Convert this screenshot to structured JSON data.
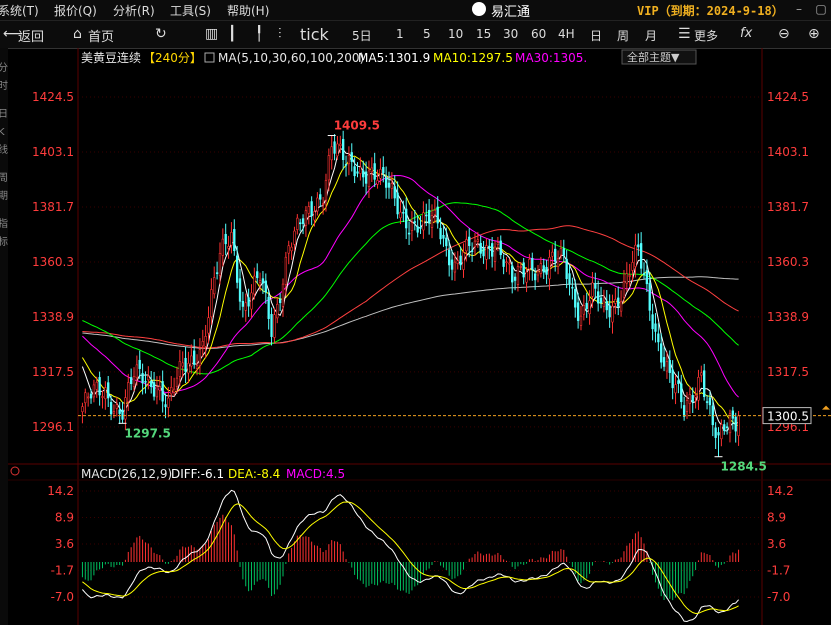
{
  "menu": {
    "items": [
      "系统(T)",
      "报价(Q)",
      "分析(R)",
      "工具(S)",
      "帮助(H)"
    ],
    "brand": "易汇通",
    "vip": "VIP（到期：2024-9-18）"
  },
  "toolbar": {
    "back": "返回",
    "home": "首页",
    "tick": "tick",
    "periods": [
      "5日",
      "1",
      "5",
      "10",
      "15",
      "30",
      "60",
      "4H",
      "日",
      "周",
      "月"
    ],
    "more": "更多",
    "fx": "fx"
  },
  "sidebar_text": [
    "分",
    "时",
    "日",
    "K",
    "线",
    "周",
    "期",
    "指",
    "标"
  ],
  "colors": {
    "up": "#ff3232",
    "down": "#54ffff",
    "bull_fill": "#000000",
    "ma5": "#ffffff",
    "ma10": "#ffff00",
    "ma30": "#ff00ff",
    "ma60": "#00ff00",
    "ma100": "#ff4040",
    "ma200": "#c0c0c0",
    "price_axis": "#ff3c3c",
    "macd_dif": "#ffffff",
    "macd_dea": "#ffff00"
  },
  "header": {
    "symbol": "美黄豆连续",
    "period": "【240分】",
    "ma_params": "MA(5,10,30,60,100,200)",
    "ma5": "MA5:1301.9",
    "ma10": "MA10:1297.5",
    "ma30": "MA30:1305.",
    "theme_btn": "全部主题▼"
  },
  "macd_header": {
    "params": "MACD(26,12,9)",
    "diff": "DIFF:-6.1",
    "dea": "DEA:-8.4",
    "macd": "MACD:4.5"
  },
  "chart_data": [
    {
      "type": "candlestick",
      "title": "美黄豆连续【240分】",
      "ylim": [
        1284.0,
        1435.0
      ],
      "y_ticks": [
        "1424.5",
        "1403.1",
        "1381.7",
        "1360.3",
        "1338.9",
        "1317.5",
        "1296.1"
      ],
      "y_tick_values": [
        1424.5,
        1403.1,
        1381.7,
        1360.3,
        1338.9,
        1317.5,
        1296.1
      ],
      "current_price": 1300.5,
      "current_price_label": "1300.5",
      "annotations": [
        {
          "label": "1409.5",
          "value": 1409.5,
          "bar": 87,
          "type": "high"
        },
        {
          "label": "1297.5",
          "value": 1297.5,
          "bar": 14,
          "type": "low"
        },
        {
          "label": "1284.5",
          "value": 1284.5,
          "bar": 222,
          "type": "low"
        }
      ],
      "series": [
        {
          "name": "MA5",
          "value": 1301.9
        },
        {
          "name": "MA10",
          "value": 1297.5
        },
        {
          "name": "MA30",
          "value": 1305.0
        }
      ],
      "close_anchors": [
        [
          0,
          1304
        ],
        [
          8,
          1310
        ],
        [
          14,
          1303
        ],
        [
          18,
          1314
        ],
        [
          26,
          1315
        ],
        [
          30,
          1304
        ],
        [
          35,
          1318
        ],
        [
          42,
          1330
        ],
        [
          48,
          1360
        ],
        [
          52,
          1372
        ],
        [
          56,
          1344
        ],
        [
          62,
          1352
        ],
        [
          66,
          1334
        ],
        [
          72,
          1368
        ],
        [
          78,
          1375
        ],
        [
          84,
          1390
        ],
        [
          87,
          1407
        ],
        [
          92,
          1396
        ],
        [
          100,
          1398
        ],
        [
          106,
          1388
        ],
        [
          112,
          1380
        ],
        [
          118,
          1373
        ],
        [
          124,
          1376
        ],
        [
          130,
          1360
        ],
        [
          138,
          1365
        ],
        [
          144,
          1370
        ],
        [
          150,
          1350
        ],
        [
          156,
          1362
        ],
        [
          162,
          1356
        ],
        [
          168,
          1362
        ],
        [
          174,
          1340
        ],
        [
          178,
          1346
        ],
        [
          182,
          1341
        ],
        [
          188,
          1350
        ],
        [
          194,
          1362
        ],
        [
          200,
          1335
        ],
        [
          206,
          1312
        ],
        [
          210,
          1300
        ],
        [
          216,
          1320
        ],
        [
          220,
          1296
        ],
        [
          222,
          1288
        ],
        [
          226,
          1298
        ],
        [
          229,
          1300.5
        ]
      ]
    },
    {
      "type": "bar",
      "title": "MACD(26,12,9)",
      "ylim": [
        -12.0,
        16.0
      ],
      "y_ticks": [
        "14.2",
        "8.9",
        "3.6",
        "-1.7",
        "-7.0"
      ],
      "y_tick_values": [
        14.2,
        8.9,
        3.6,
        -1.7,
        -7.0
      ],
      "series": [
        {
          "name": "DIFF",
          "value": -6.1
        },
        {
          "name": "DEA",
          "value": -8.4
        },
        {
          "name": "MACD",
          "value": 4.5
        }
      ]
    }
  ]
}
